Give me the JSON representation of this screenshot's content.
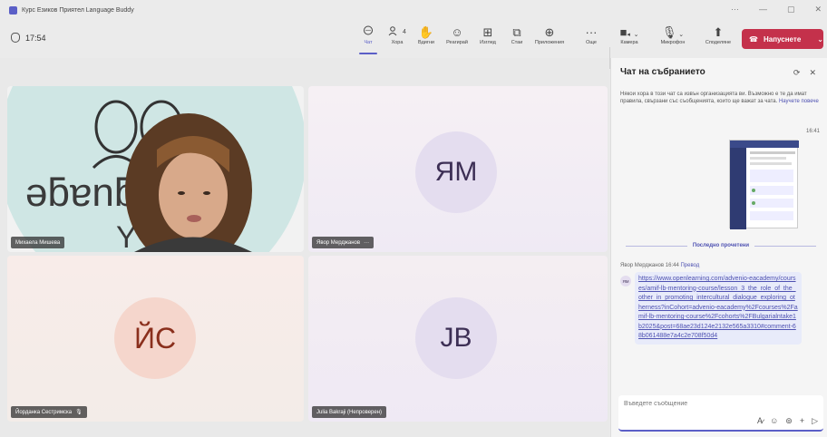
{
  "window": {
    "title": "Курс Езиков Приятел Language Buddy",
    "controls": [
      "···",
      "—",
      "▢",
      "✕"
    ]
  },
  "meeting": {
    "timer": "17:54"
  },
  "toolbar": {
    "chat": "Чат",
    "people": "Хора",
    "people_count": "4",
    "raise": "Вдигни",
    "react": "Реагирай",
    "view": "Изглед",
    "rooms": "Стаи",
    "apps": "Приложения",
    "more": "Още",
    "camera": "Камера",
    "mic": "Микрофон",
    "share": "Споделяне",
    "leave": "Напуснете"
  },
  "participants": [
    {
      "name": "Михаела Мишева",
      "logo_line1": "ǝƃɐnƃuɐ˥",
      "logo_line2": "Y"
    },
    {
      "name": "Явор Мерджанов",
      "initials": "ЯМ"
    },
    {
      "name": "Йорданка Сестримска",
      "initials": "ЙС"
    },
    {
      "name": "Julia Bakraji (Непроверен)",
      "initials": "JB"
    }
  ],
  "chat": {
    "title": "Чат на събранието",
    "notice": "Някои хора в този чат са извън организацията ви. Възможно е те да имат правила, свързани със съобщенията, които ще важат за чата.",
    "learn_more": "Научете повече",
    "shared_time": "16:41",
    "last_read": "Последно прочетени",
    "message": {
      "author": "Явор Мерджанов",
      "time": "16:44",
      "translate": "Превод",
      "avatar": "ЯМ",
      "text": "https://www.openlearning.com/advenio-eacademy/courses/amif-lb-mentoring-course/lesson_3_the_role_of_the_other_in_promoting_intercultural_dialogue_exploring_otherness?inCohort=advenio-eacademy%2Fcourses%2Famif-lb-mentoring-course%2Fcohorts%2FBulgarialntake1b2025&post=68ae23d124e2132e565a3310#comment-68b061488e7a4c2e708f50d4"
    },
    "compose_placeholder": "Въведете съобщение"
  }
}
